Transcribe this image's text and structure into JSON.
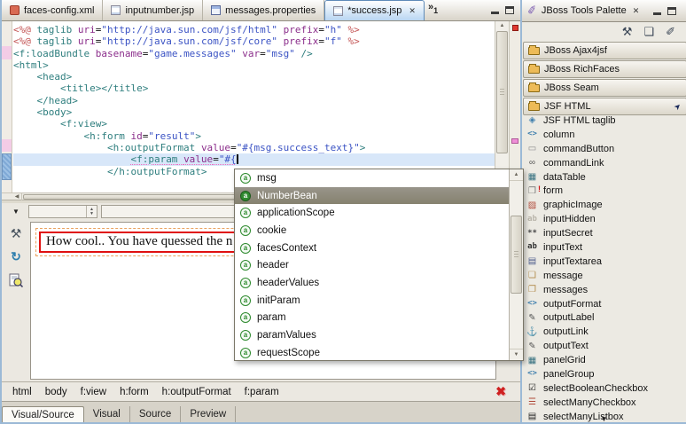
{
  "editor": {
    "tabs": [
      {
        "label": "faces-config.xml",
        "icon": "xml-file-icon",
        "active": false
      },
      {
        "label": "inputnumber.jsp",
        "icon": "jsp-file-icon",
        "active": false
      },
      {
        "label": "messages.properties",
        "icon": "properties-file-icon",
        "active": false
      },
      {
        "label": "*success.jsp",
        "icon": "jsp-file-icon",
        "active": true
      }
    ],
    "overflow_count": "1",
    "caret_line": 11,
    "code_lines": [
      [
        [
          "jsp",
          "<%@ "
        ],
        [
          "tag",
          "taglib "
        ],
        [
          "attr",
          "uri"
        ],
        [
          "pl",
          "="
        ],
        [
          "str",
          "\"http://java.sun.com/jsf/html\""
        ],
        [
          "pl",
          " "
        ],
        [
          "attr",
          "prefix"
        ],
        [
          "pl",
          "="
        ],
        [
          "str",
          "\"h\""
        ],
        [
          "pl",
          " "
        ],
        [
          "jsp",
          "%>"
        ]
      ],
      [
        [
          "jsp",
          "<%@ "
        ],
        [
          "tag",
          "taglib "
        ],
        [
          "attr",
          "uri"
        ],
        [
          "pl",
          "="
        ],
        [
          "str",
          "\"http://java.sun.com/jsf/core\""
        ],
        [
          "pl",
          " "
        ],
        [
          "attr",
          "prefix"
        ],
        [
          "pl",
          "="
        ],
        [
          "str",
          "\"f\""
        ],
        [
          "pl",
          " "
        ],
        [
          "jsp",
          "%>"
        ]
      ],
      [
        [
          "tag",
          "<f:loadBundle "
        ],
        [
          "attr",
          "basename"
        ],
        [
          "pl",
          "="
        ],
        [
          "str",
          "\"game.messages\""
        ],
        [
          "pl",
          " "
        ],
        [
          "attr",
          "var"
        ],
        [
          "pl",
          "="
        ],
        [
          "str",
          "\"msg\""
        ],
        [
          "tag",
          " />"
        ]
      ],
      [
        [
          "tag",
          "<html>"
        ]
      ],
      [
        [
          "pl",
          "    "
        ],
        [
          "tag",
          "<head>"
        ]
      ],
      [
        [
          "pl",
          "        "
        ],
        [
          "tag",
          "<title></title>"
        ]
      ],
      [
        [
          "pl",
          "    "
        ],
        [
          "tag",
          "</head>"
        ]
      ],
      [
        [
          "pl",
          "    "
        ],
        [
          "tag",
          "<body>"
        ]
      ],
      [
        [
          "pl",
          "        "
        ],
        [
          "tag",
          "<f:view>"
        ]
      ],
      [
        [
          "pl",
          "            "
        ],
        [
          "tag",
          "<h:form "
        ],
        [
          "attr",
          "id"
        ],
        [
          "pl",
          "="
        ],
        [
          "str",
          "\"result\""
        ],
        [
          "tag",
          ">"
        ]
      ],
      [
        [
          "pl",
          "                "
        ],
        [
          "tag",
          "<h:outputFormat "
        ],
        [
          "attr",
          "value"
        ],
        [
          "pl",
          "="
        ],
        [
          "str",
          "\"#{msg.success_text}\""
        ],
        [
          "tag",
          ">"
        ]
      ],
      [
        [
          "pl",
          "                    "
        ],
        [
          "tag u",
          "<f:param"
        ],
        [
          "pl u",
          " "
        ],
        [
          "attr u",
          "value"
        ],
        [
          "pl u",
          "="
        ],
        [
          "str u",
          "\"#{"
        ]
      ],
      [
        [
          "pl",
          "                "
        ],
        [
          "tag",
          "</h:outputFormat>"
        ]
      ]
    ]
  },
  "popup": {
    "items": [
      "msg",
      "NumberBean",
      "applicationScope",
      "cookie",
      "facesContext",
      "header",
      "headerValues",
      "initParam",
      "param",
      "paramValues",
      "requestScope"
    ],
    "selected": "NumberBean"
  },
  "visual": {
    "preview_text": "How cool.. You have quessed the n"
  },
  "breadcrumb": {
    "items": [
      "html",
      "body",
      "f:view",
      "h:form",
      "h:outputFormat",
      "f:param"
    ]
  },
  "bottom_tabs": {
    "items": [
      "Visual/Source",
      "Visual",
      "Source",
      "Preview"
    ],
    "active": "Visual/Source"
  },
  "palette": {
    "title": "JBoss Tools Palette",
    "groups": [
      {
        "label": "JBoss Ajax4jsf",
        "pinned": false
      },
      {
        "label": "JBoss RichFaces",
        "pinned": false
      },
      {
        "label": "JBoss Seam",
        "pinned": false
      },
      {
        "label": "JSF HTML",
        "pinned": true
      }
    ],
    "items": [
      {
        "label": "JSF HTML taglib",
        "icon": "taglib-icon"
      },
      {
        "label": "column",
        "icon": "column-icon"
      },
      {
        "label": "commandButton",
        "icon": "command-button-icon"
      },
      {
        "label": "commandLink",
        "icon": "command-link-icon"
      },
      {
        "label": "dataTable",
        "icon": "data-table-icon"
      },
      {
        "label": "form",
        "icon": "form-icon"
      },
      {
        "label": "graphicImage",
        "icon": "graphic-image-icon"
      },
      {
        "label": "inputHidden",
        "icon": "input-hidden-icon"
      },
      {
        "label": "inputSecret",
        "icon": "input-secret-icon"
      },
      {
        "label": "inputText",
        "icon": "input-text-icon"
      },
      {
        "label": "inputTextarea",
        "icon": "input-textarea-icon"
      },
      {
        "label": "message",
        "icon": "message-icon"
      },
      {
        "label": "messages",
        "icon": "messages-icon"
      },
      {
        "label": "outputFormat",
        "icon": "output-format-icon"
      },
      {
        "label": "outputLabel",
        "icon": "output-label-icon"
      },
      {
        "label": "outputLink",
        "icon": "output-link-icon"
      },
      {
        "label": "outputText",
        "icon": "output-text-icon"
      },
      {
        "label": "panelGrid",
        "icon": "panel-grid-icon"
      },
      {
        "label": "panelGroup",
        "icon": "panel-group-icon"
      },
      {
        "label": "selectBooleanCheckbox",
        "icon": "select-boolean-checkbox-icon"
      },
      {
        "label": "selectManyCheckbox",
        "icon": "select-many-checkbox-icon"
      },
      {
        "label": "selectManyListbox",
        "icon": "select-many-listbox-icon"
      }
    ]
  },
  "colors": {
    "tag": "#2e7e7e",
    "attribute": "#8b2e8b",
    "string": "#3b53c4",
    "jsp_delimiter": "#c45656",
    "current_line": "#d8e7f9",
    "selection": "#8f8b7d",
    "error_red": "#e01010",
    "accent_blue": "#b9d6f2"
  }
}
